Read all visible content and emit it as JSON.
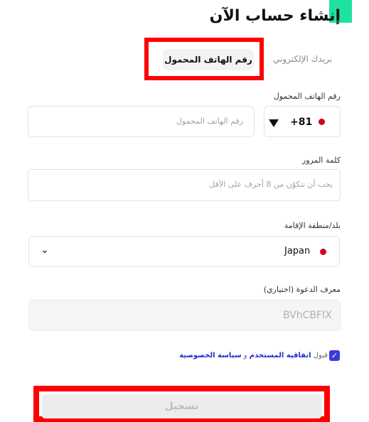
{
  "title": "إنشاء حساب الآن",
  "tabs": [
    {
      "label": "رقم الهاتف المحمول",
      "active": true
    },
    {
      "label": "بريدك الإلكتروني",
      "active": false
    }
  ],
  "phone": {
    "label": "رقم الهاتف المحمول",
    "country_code": "+81",
    "placeholder": "رقم الهاتف المحمول",
    "value": ""
  },
  "password": {
    "label": "كلمة المرور",
    "placeholder": "يجب أن تتكوّن من 8 أحرف على الأقل"
  },
  "residence": {
    "label": "بلد/منطقة الإقامة",
    "value": "Japan"
  },
  "invite": {
    "label": "معرف الدعوة (اختياري)",
    "value": "BVhCBFIX"
  },
  "agreement": {
    "prefix": "قبول",
    "terms_link": "اتفاقية المستخدم",
    "conjunction": "و",
    "privacy_link": "سياسة الخصوصية",
    "checked": true
  },
  "signup": {
    "label": "تسجيل"
  },
  "colors": {
    "accent": "#1ee2a0",
    "highlight": "#ff0000",
    "checkbox": "#3a3adf",
    "link": "#1d2ccf",
    "flag_dot": "#d4001a"
  },
  "icons": {
    "country_dropdown": "triangle-down-icon",
    "residence_dropdown": "chevron-down-icon",
    "checkbox": "checkmark-icon",
    "flag": "japan-flag-icon"
  }
}
